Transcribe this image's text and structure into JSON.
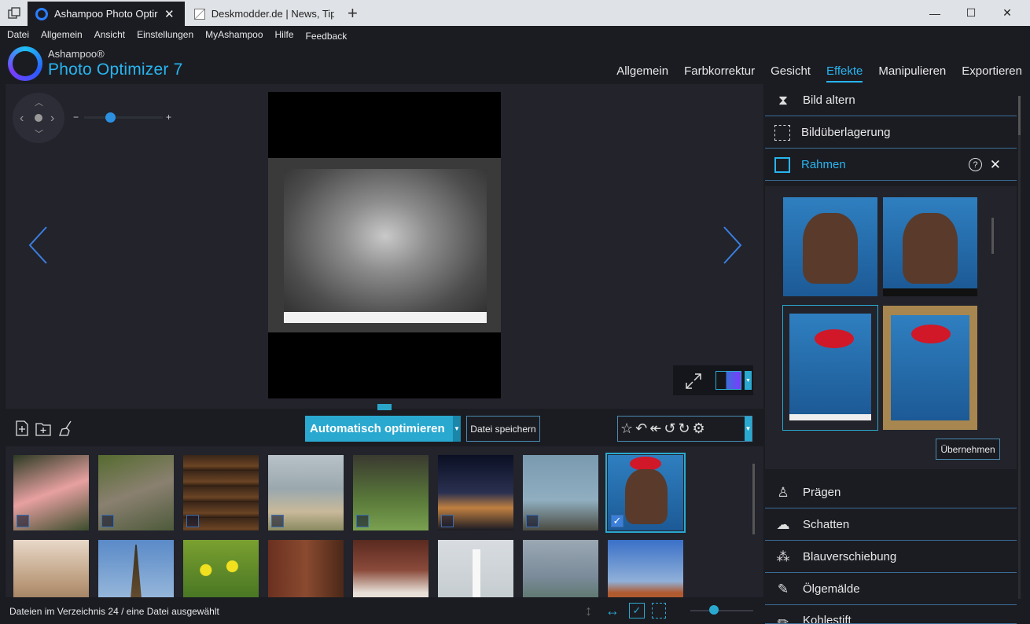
{
  "browser": {
    "tabs": [
      {
        "title": "Ashampoo Photo Optir",
        "active": true
      },
      {
        "title": "Deskmodder.de | News, Tip",
        "active": false
      }
    ],
    "new_tab_icon": "+",
    "window_controls": [
      "—",
      "☐",
      "✕"
    ]
  },
  "menu": [
    "Datei",
    "Allgemein",
    "Ansicht",
    "Einstellungen",
    "MyAshampoo",
    "Hilfe",
    "Feedback"
  ],
  "app": {
    "brand_top": "Ashampoo®",
    "brand_name": "Photo Optimizer 7",
    "accent": "#28b5f0",
    "nav": [
      {
        "label": "Allgemein",
        "active": false
      },
      {
        "label": "Farbkorrektur",
        "active": false
      },
      {
        "label": "Gesicht",
        "active": false
      },
      {
        "label": "Effekte",
        "active": true
      },
      {
        "label": "Manipulieren",
        "active": false
      },
      {
        "label": "Exportieren",
        "active": false
      }
    ]
  },
  "viewer": {
    "zoom_minus": "−",
    "zoom_plus": "+"
  },
  "panel": {
    "effects_top": [
      {
        "label": "Bild altern",
        "icon": "hourglass-icon"
      },
      {
        "label": "Bildüberlagerung",
        "icon": "overlay-icon"
      },
      {
        "label": "Rahmen",
        "icon": "frame-icon",
        "active": true
      }
    ],
    "help_icon": "?",
    "close_icon": "✕",
    "apply_label": "Übernehmen",
    "effects_bottom": [
      {
        "label": "Prägen",
        "icon": "emboss-icon"
      },
      {
        "label": "Schatten",
        "icon": "cloud-icon"
      },
      {
        "label": "Blauverschiebung",
        "icon": "color-shift-icon"
      },
      {
        "label": "Ölgemälde",
        "icon": "brush-icon"
      },
      {
        "label": "Kohlestift",
        "icon": "pencil-icon"
      }
    ]
  },
  "toolbar": {
    "auto_optimize": "Automatisch optimieren",
    "save_file": "Datei speichern"
  },
  "gallery": {
    "thumbnails": [
      {
        "name": "spoonbill",
        "checked": false
      },
      {
        "name": "monkey",
        "checked": false
      },
      {
        "name": "barrels",
        "checked": false
      },
      {
        "name": "beach-rock",
        "checked": false
      },
      {
        "name": "hoopoe",
        "checked": false
      },
      {
        "name": "city-night",
        "checked": false
      },
      {
        "name": "egret",
        "checked": false
      },
      {
        "name": "woman-cigar",
        "checked": true
      },
      {
        "name": "desert"
      },
      {
        "name": "eiffel-tower"
      },
      {
        "name": "yellow-flowers"
      },
      {
        "name": "warehouse"
      },
      {
        "name": "old-man"
      },
      {
        "name": "lighthouse"
      },
      {
        "name": "lake-coast"
      },
      {
        "name": "canyon"
      }
    ]
  },
  "status": {
    "text": "Dateien im Verzeichnis 24 / eine Datei ausgewählt"
  }
}
